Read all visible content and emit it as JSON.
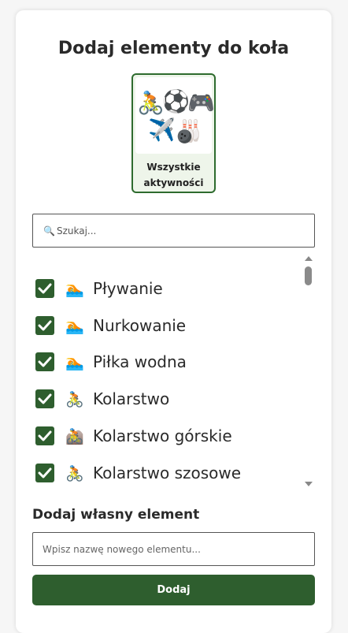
{
  "title": "Dodaj elementy do koła",
  "category": {
    "label_line1": "Wszystkie",
    "label_line2": "aktywności",
    "icons": [
      "🚴",
      "⚽",
      "🎮",
      "✈️",
      "🎳"
    ],
    "icon_names": [
      "bicycle-icon",
      "soccer-ball-icon",
      "gamepad-icon",
      "airplane-icon",
      "bowling-icon"
    ]
  },
  "search": {
    "icon": "🔍",
    "placeholder": "Szukaj..."
  },
  "items": [
    {
      "label": "Pływanie",
      "emoji": "🏊",
      "checked": true
    },
    {
      "label": "Nurkowanie",
      "emoji": "🏊",
      "checked": true
    },
    {
      "label": "Piłka wodna",
      "emoji": "🏊",
      "checked": true
    },
    {
      "label": "Kolarstwo",
      "emoji": "🚴",
      "checked": true
    },
    {
      "label": "Kolarstwo górskie",
      "emoji": "🚵",
      "checked": true
    },
    {
      "label": "Kolarstwo szosowe",
      "emoji": "🚴",
      "checked": true
    }
  ],
  "custom": {
    "section_title": "Dodaj własny element",
    "placeholder": "Wpisz nazwę nowego elementu...",
    "button_label": "Dodaj"
  },
  "colors": {
    "accent": "#2e5e2e",
    "tile_border": "#2e6b2e",
    "tile_bg": "#eef5ea"
  }
}
